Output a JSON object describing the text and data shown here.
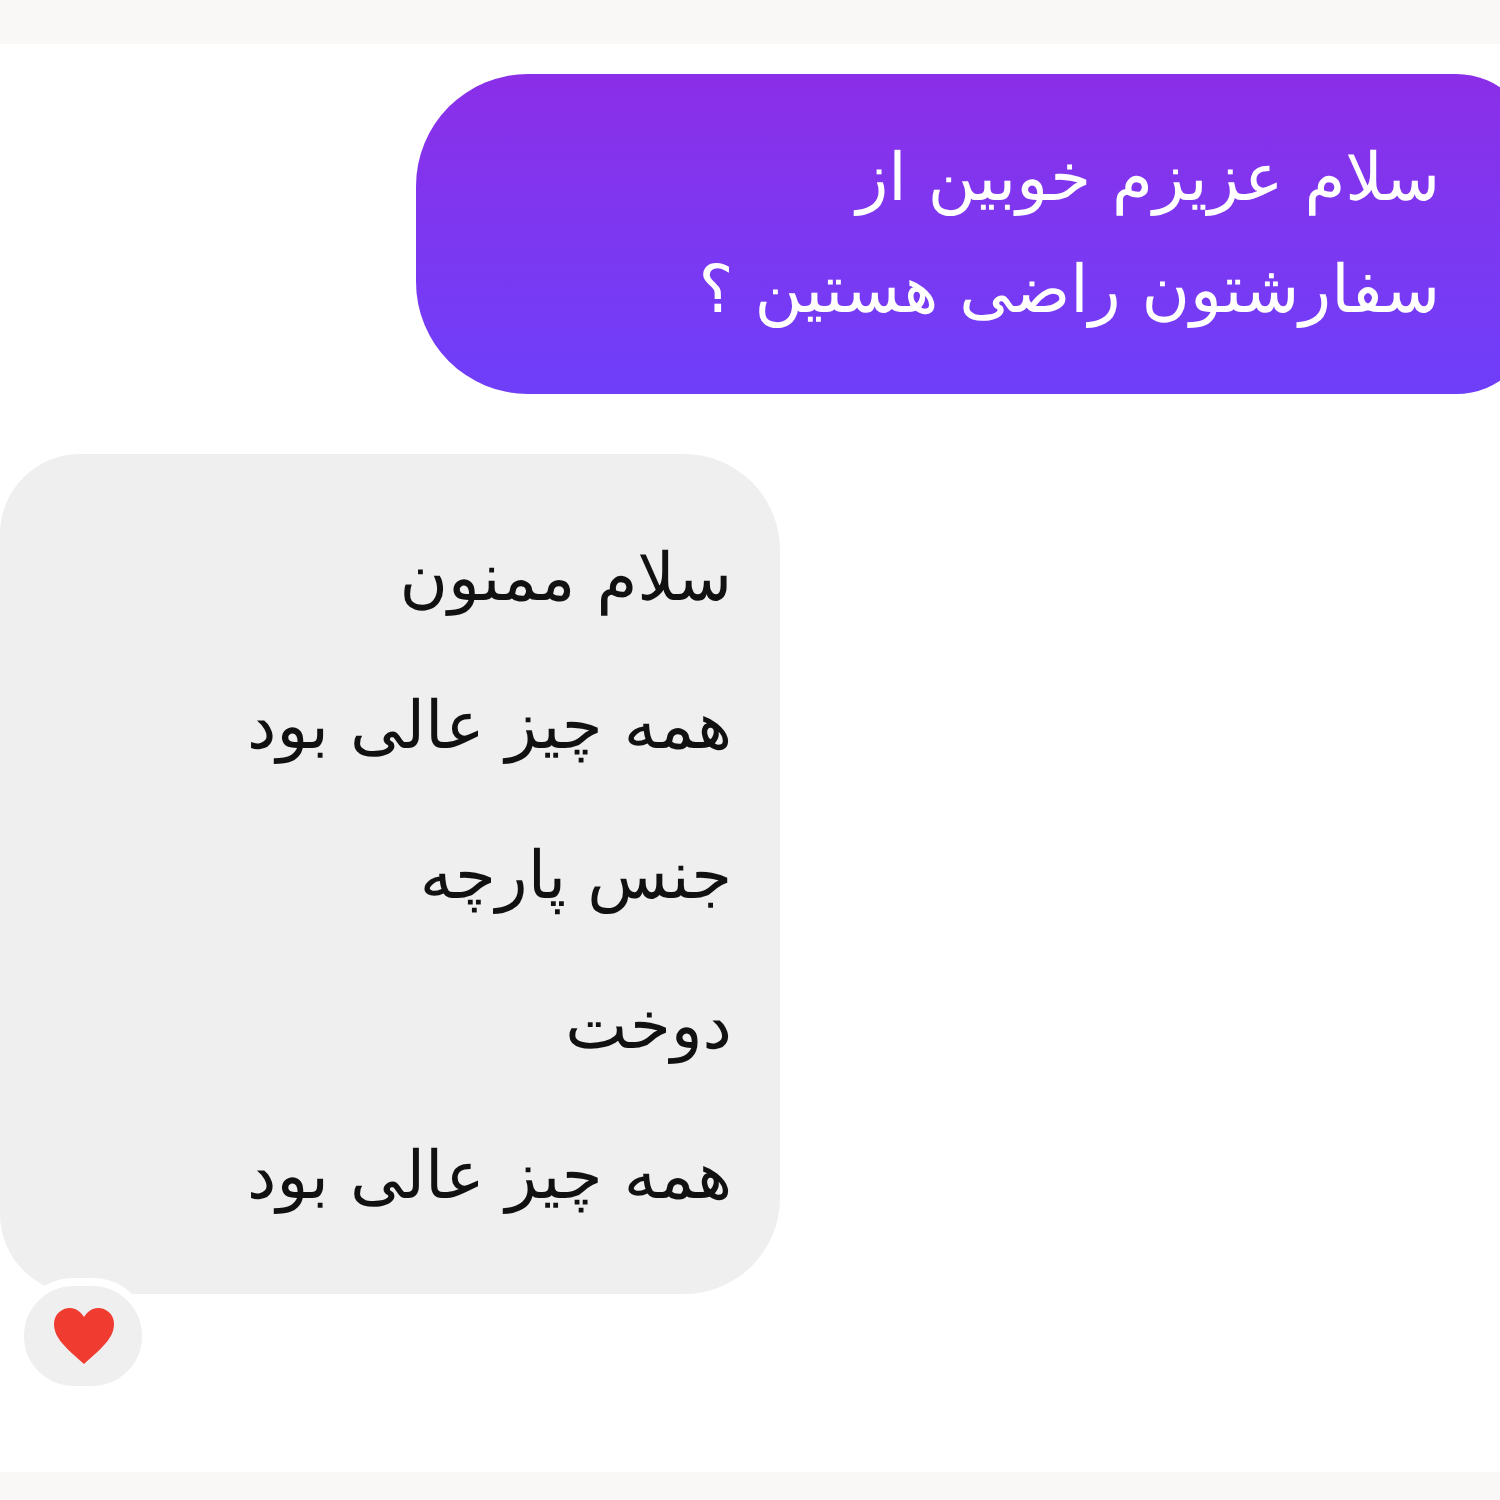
{
  "messages": [
    {
      "kind": "sent",
      "lines": [
        "سلام عزیزم خوبین از",
        "سفارشتون راضی هستین ؟"
      ],
      "reacted": false
    },
    {
      "kind": "received",
      "lines": [
        "سلام ممنون",
        "همه چیز عالی بود",
        "جنس پارچه",
        "دوخت",
        "همه چیز عالی بود"
      ],
      "reacted": true
    }
  ]
}
